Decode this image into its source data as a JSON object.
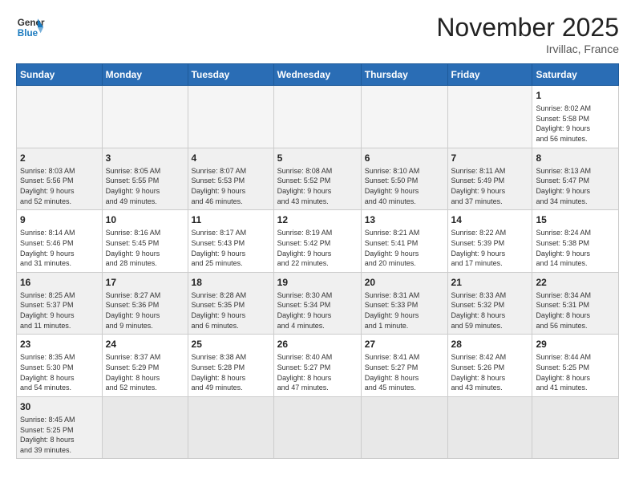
{
  "header": {
    "logo_general": "General",
    "logo_blue": "Blue",
    "month_title": "November 2025",
    "location": "Irvillac, France"
  },
  "days_of_week": [
    "Sunday",
    "Monday",
    "Tuesday",
    "Wednesday",
    "Thursday",
    "Friday",
    "Saturday"
  ],
  "weeks": [
    {
      "shaded": false,
      "days": [
        {
          "number": "",
          "info": ""
        },
        {
          "number": "",
          "info": ""
        },
        {
          "number": "",
          "info": ""
        },
        {
          "number": "",
          "info": ""
        },
        {
          "number": "",
          "info": ""
        },
        {
          "number": "",
          "info": ""
        },
        {
          "number": "1",
          "info": "Sunrise: 8:02 AM\nSunset: 5:58 PM\nDaylight: 9 hours\nand 56 minutes."
        }
      ]
    },
    {
      "shaded": true,
      "days": [
        {
          "number": "2",
          "info": "Sunrise: 8:03 AM\nSunset: 5:56 PM\nDaylight: 9 hours\nand 52 minutes."
        },
        {
          "number": "3",
          "info": "Sunrise: 8:05 AM\nSunset: 5:55 PM\nDaylight: 9 hours\nand 49 minutes."
        },
        {
          "number": "4",
          "info": "Sunrise: 8:07 AM\nSunset: 5:53 PM\nDaylight: 9 hours\nand 46 minutes."
        },
        {
          "number": "5",
          "info": "Sunrise: 8:08 AM\nSunset: 5:52 PM\nDaylight: 9 hours\nand 43 minutes."
        },
        {
          "number": "6",
          "info": "Sunrise: 8:10 AM\nSunset: 5:50 PM\nDaylight: 9 hours\nand 40 minutes."
        },
        {
          "number": "7",
          "info": "Sunrise: 8:11 AM\nSunset: 5:49 PM\nDaylight: 9 hours\nand 37 minutes."
        },
        {
          "number": "8",
          "info": "Sunrise: 8:13 AM\nSunset: 5:47 PM\nDaylight: 9 hours\nand 34 minutes."
        }
      ]
    },
    {
      "shaded": false,
      "days": [
        {
          "number": "9",
          "info": "Sunrise: 8:14 AM\nSunset: 5:46 PM\nDaylight: 9 hours\nand 31 minutes."
        },
        {
          "number": "10",
          "info": "Sunrise: 8:16 AM\nSunset: 5:45 PM\nDaylight: 9 hours\nand 28 minutes."
        },
        {
          "number": "11",
          "info": "Sunrise: 8:17 AM\nSunset: 5:43 PM\nDaylight: 9 hours\nand 25 minutes."
        },
        {
          "number": "12",
          "info": "Sunrise: 8:19 AM\nSunset: 5:42 PM\nDaylight: 9 hours\nand 22 minutes."
        },
        {
          "number": "13",
          "info": "Sunrise: 8:21 AM\nSunset: 5:41 PM\nDaylight: 9 hours\nand 20 minutes."
        },
        {
          "number": "14",
          "info": "Sunrise: 8:22 AM\nSunset: 5:39 PM\nDaylight: 9 hours\nand 17 minutes."
        },
        {
          "number": "15",
          "info": "Sunrise: 8:24 AM\nSunset: 5:38 PM\nDaylight: 9 hours\nand 14 minutes."
        }
      ]
    },
    {
      "shaded": true,
      "days": [
        {
          "number": "16",
          "info": "Sunrise: 8:25 AM\nSunset: 5:37 PM\nDaylight: 9 hours\nand 11 minutes."
        },
        {
          "number": "17",
          "info": "Sunrise: 8:27 AM\nSunset: 5:36 PM\nDaylight: 9 hours\nand 9 minutes."
        },
        {
          "number": "18",
          "info": "Sunrise: 8:28 AM\nSunset: 5:35 PM\nDaylight: 9 hours\nand 6 minutes."
        },
        {
          "number": "19",
          "info": "Sunrise: 8:30 AM\nSunset: 5:34 PM\nDaylight: 9 hours\nand 4 minutes."
        },
        {
          "number": "20",
          "info": "Sunrise: 8:31 AM\nSunset: 5:33 PM\nDaylight: 9 hours\nand 1 minute."
        },
        {
          "number": "21",
          "info": "Sunrise: 8:33 AM\nSunset: 5:32 PM\nDaylight: 8 hours\nand 59 minutes."
        },
        {
          "number": "22",
          "info": "Sunrise: 8:34 AM\nSunset: 5:31 PM\nDaylight: 8 hours\nand 56 minutes."
        }
      ]
    },
    {
      "shaded": false,
      "days": [
        {
          "number": "23",
          "info": "Sunrise: 8:35 AM\nSunset: 5:30 PM\nDaylight: 8 hours\nand 54 minutes."
        },
        {
          "number": "24",
          "info": "Sunrise: 8:37 AM\nSunset: 5:29 PM\nDaylight: 8 hours\nand 52 minutes."
        },
        {
          "number": "25",
          "info": "Sunrise: 8:38 AM\nSunset: 5:28 PM\nDaylight: 8 hours\nand 49 minutes."
        },
        {
          "number": "26",
          "info": "Sunrise: 8:40 AM\nSunset: 5:27 PM\nDaylight: 8 hours\nand 47 minutes."
        },
        {
          "number": "27",
          "info": "Sunrise: 8:41 AM\nSunset: 5:27 PM\nDaylight: 8 hours\nand 45 minutes."
        },
        {
          "number": "28",
          "info": "Sunrise: 8:42 AM\nSunset: 5:26 PM\nDaylight: 8 hours\nand 43 minutes."
        },
        {
          "number": "29",
          "info": "Sunrise: 8:44 AM\nSunset: 5:25 PM\nDaylight: 8 hours\nand 41 minutes."
        }
      ]
    },
    {
      "shaded": true,
      "days": [
        {
          "number": "30",
          "info": "Sunrise: 8:45 AM\nSunset: 5:25 PM\nDaylight: 8 hours\nand 39 minutes."
        },
        {
          "number": "",
          "info": ""
        },
        {
          "number": "",
          "info": ""
        },
        {
          "number": "",
          "info": ""
        },
        {
          "number": "",
          "info": ""
        },
        {
          "number": "",
          "info": ""
        },
        {
          "number": "",
          "info": ""
        }
      ]
    }
  ]
}
